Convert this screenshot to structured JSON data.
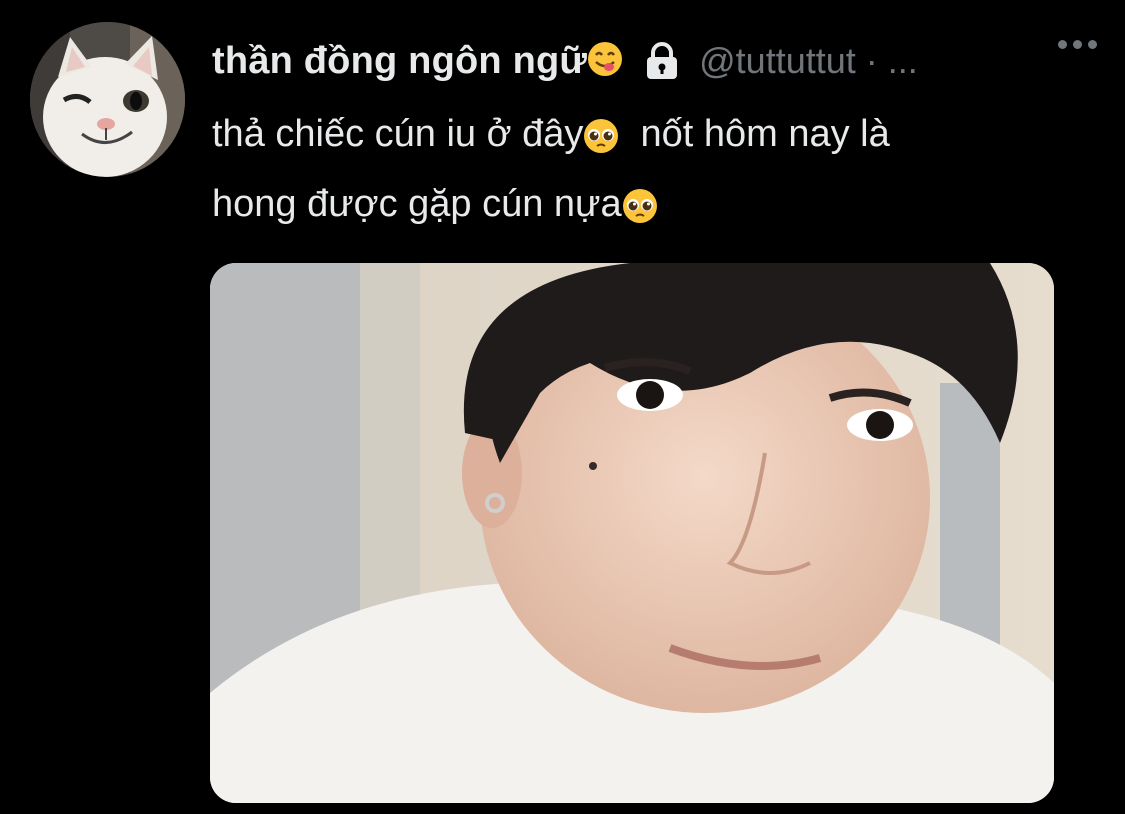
{
  "tweet": {
    "display_name": "thần đồng ngôn ngữ",
    "name_emoji": "😋",
    "handle": "@tuttuttut",
    "separator": "·",
    "time": "...",
    "text_line1_a": "thả chiếc cún iu ở đây",
    "emoji_pleading": "🥺",
    "text_line1_b": "nốt hôm nay là",
    "text_line2": "hong được gặp cún nựa",
    "icons": {
      "lock": "lock-icon",
      "more": "more-horizontal-icon",
      "avatar": "cat-avatar",
      "media": "selfie-photo"
    }
  },
  "colors": {
    "background": "#000000",
    "text_primary": "#e7e9ea",
    "text_secondary": "#71767b"
  }
}
